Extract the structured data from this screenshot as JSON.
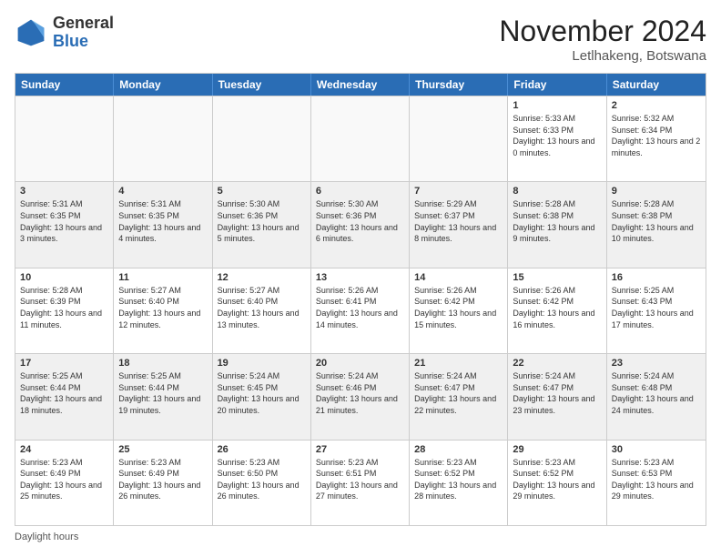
{
  "header": {
    "logo_general": "General",
    "logo_blue": "Blue",
    "month_title": "November 2024",
    "location": "Letlhakeng, Botswana"
  },
  "days_of_week": [
    "Sunday",
    "Monday",
    "Tuesday",
    "Wednesday",
    "Thursday",
    "Friday",
    "Saturday"
  ],
  "footer": {
    "daylight_label": "Daylight hours"
  },
  "weeks": [
    [
      {
        "day": "",
        "info": ""
      },
      {
        "day": "",
        "info": ""
      },
      {
        "day": "",
        "info": ""
      },
      {
        "day": "",
        "info": ""
      },
      {
        "day": "",
        "info": ""
      },
      {
        "day": "1",
        "info": "Sunrise: 5:33 AM\nSunset: 6:33 PM\nDaylight: 13 hours and 0 minutes."
      },
      {
        "day": "2",
        "info": "Sunrise: 5:32 AM\nSunset: 6:34 PM\nDaylight: 13 hours and 2 minutes."
      }
    ],
    [
      {
        "day": "3",
        "info": "Sunrise: 5:31 AM\nSunset: 6:35 PM\nDaylight: 13 hours and 3 minutes."
      },
      {
        "day": "4",
        "info": "Sunrise: 5:31 AM\nSunset: 6:35 PM\nDaylight: 13 hours and 4 minutes."
      },
      {
        "day": "5",
        "info": "Sunrise: 5:30 AM\nSunset: 6:36 PM\nDaylight: 13 hours and 5 minutes."
      },
      {
        "day": "6",
        "info": "Sunrise: 5:30 AM\nSunset: 6:36 PM\nDaylight: 13 hours and 6 minutes."
      },
      {
        "day": "7",
        "info": "Sunrise: 5:29 AM\nSunset: 6:37 PM\nDaylight: 13 hours and 8 minutes."
      },
      {
        "day": "8",
        "info": "Sunrise: 5:28 AM\nSunset: 6:38 PM\nDaylight: 13 hours and 9 minutes."
      },
      {
        "day": "9",
        "info": "Sunrise: 5:28 AM\nSunset: 6:38 PM\nDaylight: 13 hours and 10 minutes."
      }
    ],
    [
      {
        "day": "10",
        "info": "Sunrise: 5:28 AM\nSunset: 6:39 PM\nDaylight: 13 hours and 11 minutes."
      },
      {
        "day": "11",
        "info": "Sunrise: 5:27 AM\nSunset: 6:40 PM\nDaylight: 13 hours and 12 minutes."
      },
      {
        "day": "12",
        "info": "Sunrise: 5:27 AM\nSunset: 6:40 PM\nDaylight: 13 hours and 13 minutes."
      },
      {
        "day": "13",
        "info": "Sunrise: 5:26 AM\nSunset: 6:41 PM\nDaylight: 13 hours and 14 minutes."
      },
      {
        "day": "14",
        "info": "Sunrise: 5:26 AM\nSunset: 6:42 PM\nDaylight: 13 hours and 15 minutes."
      },
      {
        "day": "15",
        "info": "Sunrise: 5:26 AM\nSunset: 6:42 PM\nDaylight: 13 hours and 16 minutes."
      },
      {
        "day": "16",
        "info": "Sunrise: 5:25 AM\nSunset: 6:43 PM\nDaylight: 13 hours and 17 minutes."
      }
    ],
    [
      {
        "day": "17",
        "info": "Sunrise: 5:25 AM\nSunset: 6:44 PM\nDaylight: 13 hours and 18 minutes."
      },
      {
        "day": "18",
        "info": "Sunrise: 5:25 AM\nSunset: 6:44 PM\nDaylight: 13 hours and 19 minutes."
      },
      {
        "day": "19",
        "info": "Sunrise: 5:24 AM\nSunset: 6:45 PM\nDaylight: 13 hours and 20 minutes."
      },
      {
        "day": "20",
        "info": "Sunrise: 5:24 AM\nSunset: 6:46 PM\nDaylight: 13 hours and 21 minutes."
      },
      {
        "day": "21",
        "info": "Sunrise: 5:24 AM\nSunset: 6:47 PM\nDaylight: 13 hours and 22 minutes."
      },
      {
        "day": "22",
        "info": "Sunrise: 5:24 AM\nSunset: 6:47 PM\nDaylight: 13 hours and 23 minutes."
      },
      {
        "day": "23",
        "info": "Sunrise: 5:24 AM\nSunset: 6:48 PM\nDaylight: 13 hours and 24 minutes."
      }
    ],
    [
      {
        "day": "24",
        "info": "Sunrise: 5:23 AM\nSunset: 6:49 PM\nDaylight: 13 hours and 25 minutes."
      },
      {
        "day": "25",
        "info": "Sunrise: 5:23 AM\nSunset: 6:49 PM\nDaylight: 13 hours and 26 minutes."
      },
      {
        "day": "26",
        "info": "Sunrise: 5:23 AM\nSunset: 6:50 PM\nDaylight: 13 hours and 26 minutes."
      },
      {
        "day": "27",
        "info": "Sunrise: 5:23 AM\nSunset: 6:51 PM\nDaylight: 13 hours and 27 minutes."
      },
      {
        "day": "28",
        "info": "Sunrise: 5:23 AM\nSunset: 6:52 PM\nDaylight: 13 hours and 28 minutes."
      },
      {
        "day": "29",
        "info": "Sunrise: 5:23 AM\nSunset: 6:52 PM\nDaylight: 13 hours and 29 minutes."
      },
      {
        "day": "30",
        "info": "Sunrise: 5:23 AM\nSunset: 6:53 PM\nDaylight: 13 hours and 29 minutes."
      }
    ]
  ]
}
